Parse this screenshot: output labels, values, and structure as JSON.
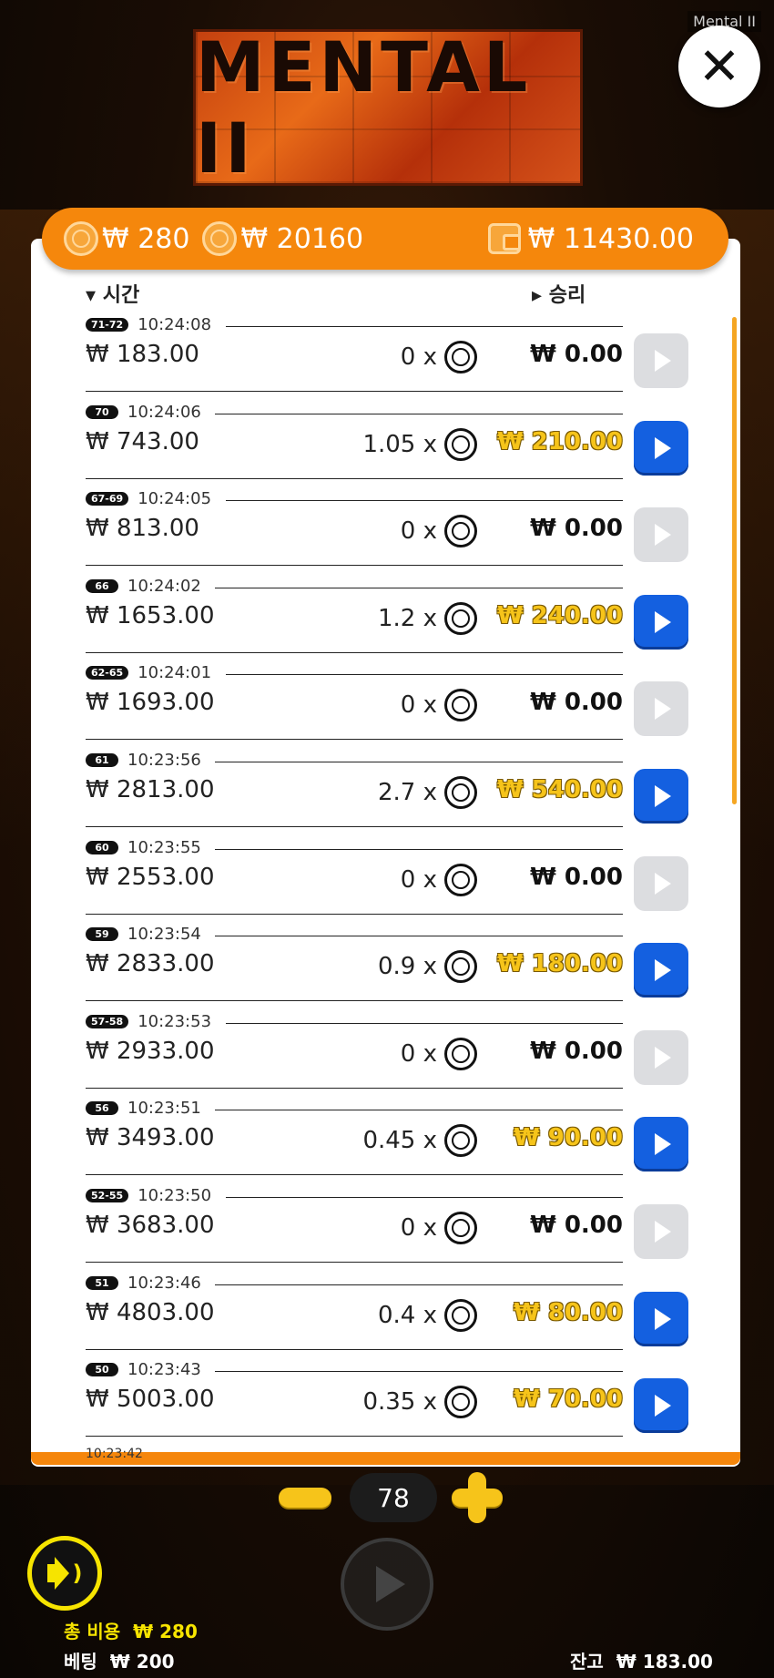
{
  "watermark": "Mental II",
  "logo": {
    "text": "MENTAL II"
  },
  "topbar": {
    "coin1": "₩ 280",
    "coin2": "₩ 20160",
    "wallet": "₩ 11430.00"
  },
  "headers": {
    "time": "시간",
    "win": "승리"
  },
  "rows": [
    {
      "round": "71-72",
      "time": "10:24:08",
      "balance": "₩ 183.00",
      "mult": "0 x",
      "win": "₩ 0.00",
      "active": false
    },
    {
      "round": "70",
      "time": "10:24:06",
      "balance": "₩ 743.00",
      "mult": "1.05 x",
      "win": "₩ 210.00",
      "active": true
    },
    {
      "round": "67-69",
      "time": "10:24:05",
      "balance": "₩ 813.00",
      "mult": "0 x",
      "win": "₩ 0.00",
      "active": false
    },
    {
      "round": "66",
      "time": "10:24:02",
      "balance": "₩ 1653.00",
      "mult": "1.2 x",
      "win": "₩ 240.00",
      "active": true
    },
    {
      "round": "62-65",
      "time": "10:24:01",
      "balance": "₩ 1693.00",
      "mult": "0 x",
      "win": "₩ 0.00",
      "active": false
    },
    {
      "round": "61",
      "time": "10:23:56",
      "balance": "₩ 2813.00",
      "mult": "2.7 x",
      "win": "₩ 540.00",
      "active": true
    },
    {
      "round": "60",
      "time": "10:23:55",
      "balance": "₩ 2553.00",
      "mult": "0 x",
      "win": "₩ 0.00",
      "active": false
    },
    {
      "round": "59",
      "time": "10:23:54",
      "balance": "₩ 2833.00",
      "mult": "0.9 x",
      "win": "₩ 180.00",
      "active": true
    },
    {
      "round": "57-58",
      "time": "10:23:53",
      "balance": "₩ 2933.00",
      "mult": "0 x",
      "win": "₩ 0.00",
      "active": false
    },
    {
      "round": "56",
      "time": "10:23:51",
      "balance": "₩ 3493.00",
      "mult": "0.45 x",
      "win": "₩ 90.00",
      "active": true
    },
    {
      "round": "52-55",
      "time": "10:23:50",
      "balance": "₩ 3683.00",
      "mult": "0 x",
      "win": "₩ 0.00",
      "active": false
    },
    {
      "round": "51",
      "time": "10:23:46",
      "balance": "₩ 4803.00",
      "mult": "0.4 x",
      "win": "₩ 80.00",
      "active": true
    },
    {
      "round": "50",
      "time": "10:23:43",
      "balance": "₩ 5003.00",
      "mult": "0.35 x",
      "win": "₩ 70.00",
      "active": true
    }
  ],
  "cutoff_time": "10:23:42",
  "stepper": {
    "value": "78"
  },
  "footer": {
    "cost_label": "총 비용",
    "cost_value": "₩ 280",
    "bet_label": "베팅",
    "bet_value": "₩ 200",
    "balance_label": "잔고",
    "balance_value": "₩ 183.00"
  },
  "colors": {
    "accent_orange": "#f5870c",
    "win_yellow": "#f6c41a",
    "play_blue": "#1460e0"
  }
}
